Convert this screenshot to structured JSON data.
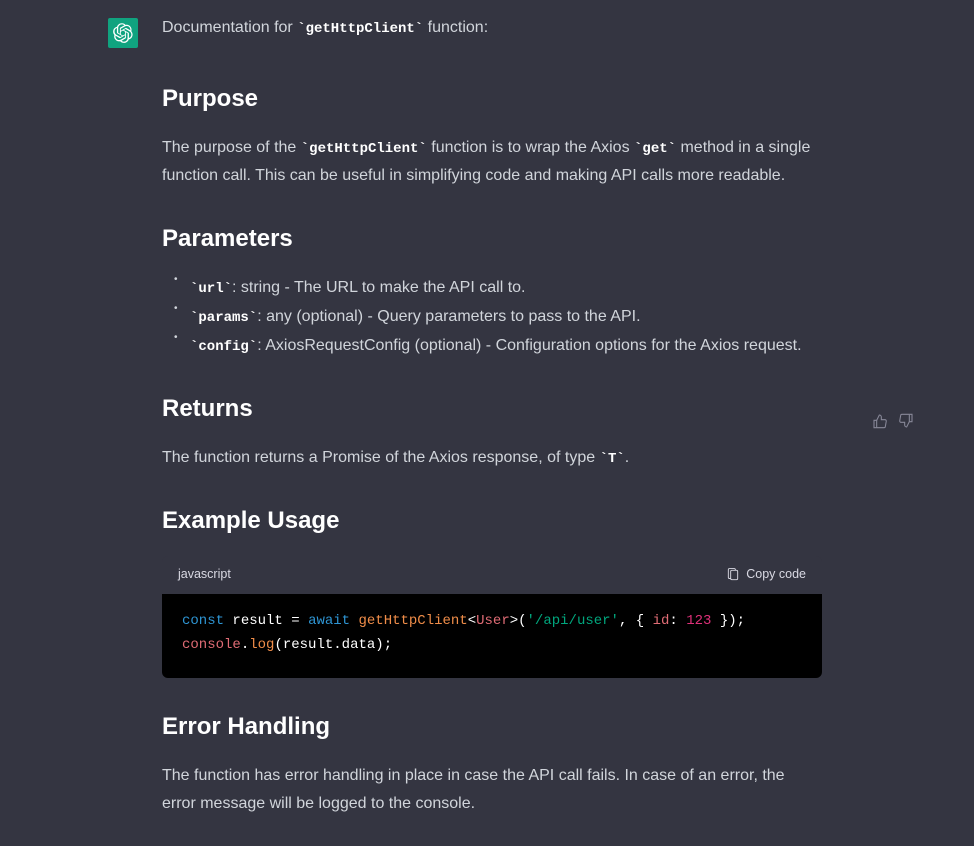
{
  "intro": {
    "prefix": "Documentation for ",
    "code": "`getHttpClient`",
    "suffix": " function:"
  },
  "sections": {
    "purpose": {
      "heading": "Purpose",
      "text_parts": {
        "p1": "The purpose of the ",
        "c1": "`getHttpClient`",
        "p2": " function is to wrap the Axios ",
        "c2": "`get`",
        "p3": " method in a single function call. This can be useful in simplifying code and making API calls more readable."
      }
    },
    "parameters": {
      "heading": "Parameters",
      "items": [
        {
          "name": "`url`",
          "desc": ": string - The URL to make the API call to."
        },
        {
          "name": "`params`",
          "desc": ": any (optional) - Query parameters to pass to the API."
        },
        {
          "name": "`config`",
          "desc": ": AxiosRequestConfig (optional) - Configuration options for the Axios request."
        }
      ]
    },
    "returns": {
      "heading": "Returns",
      "text_parts": {
        "p1": "The function returns a Promise of the Axios response, of type ",
        "c1": "`T`",
        "p2": "."
      }
    },
    "example": {
      "heading": "Example Usage",
      "language": "javascript",
      "copy_label": "Copy code",
      "code_tokens": {
        "l1": {
          "kw1": "const",
          "sp1": " ",
          "id1": "result",
          "sp2": " ",
          "op1": "=",
          "sp3": " ",
          "kw2": "await",
          "sp4": " ",
          "fn": "getHttpClient",
          "lt": "<",
          "type": "User",
          "gt": ">",
          "lp": "(",
          "str": "'/api/user'",
          "comma": ", ",
          "lb": "{ ",
          "prop": "id",
          "colon": ": ",
          "num": "123",
          "rb": " }",
          "rp": ")",
          "semi": ";"
        },
        "l2": {
          "obj": "console",
          "dot": ".",
          "fn": "log",
          "lp": "(",
          "id1": "result",
          "dot2": ".",
          "id2": "data",
          "rp": ")",
          "semi": ";"
        }
      }
    },
    "errors": {
      "heading": "Error Handling",
      "text": "The function has error handling in place in case the API call fails. In case of an error, the error message will be logged to the console."
    }
  }
}
